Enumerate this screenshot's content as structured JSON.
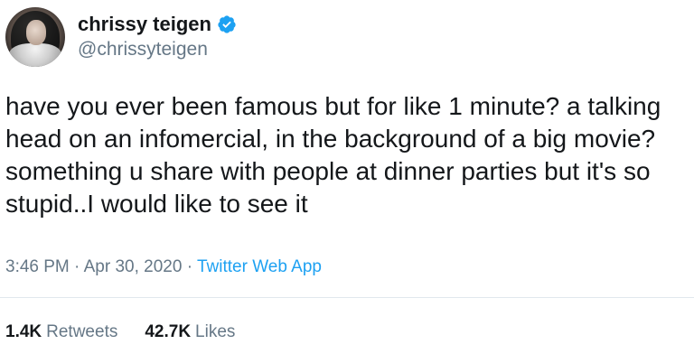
{
  "author": {
    "display_name": "chrissy teigen",
    "handle": "@chrissyteigen",
    "verified": true
  },
  "tweet": {
    "text": "have you ever been famous but for like 1 minute? a talking head on an infomercial, in the background of a big movie? something u share with people at dinner parties but it's so stupid..I would like to see it",
    "time": "3:46 PM",
    "separator": "·",
    "date": "Apr 30, 2020",
    "source": "Twitter Web App"
  },
  "stats": {
    "retweets_count": "1.4K",
    "retweets_label": "Retweets",
    "likes_count": "42.7K",
    "likes_label": "Likes"
  },
  "colors": {
    "text": "#14171a",
    "secondary": "#657786",
    "accent": "#1da1f2",
    "divider": "#e1e8ed"
  },
  "icons": {
    "verified": "verified-badge-icon"
  }
}
